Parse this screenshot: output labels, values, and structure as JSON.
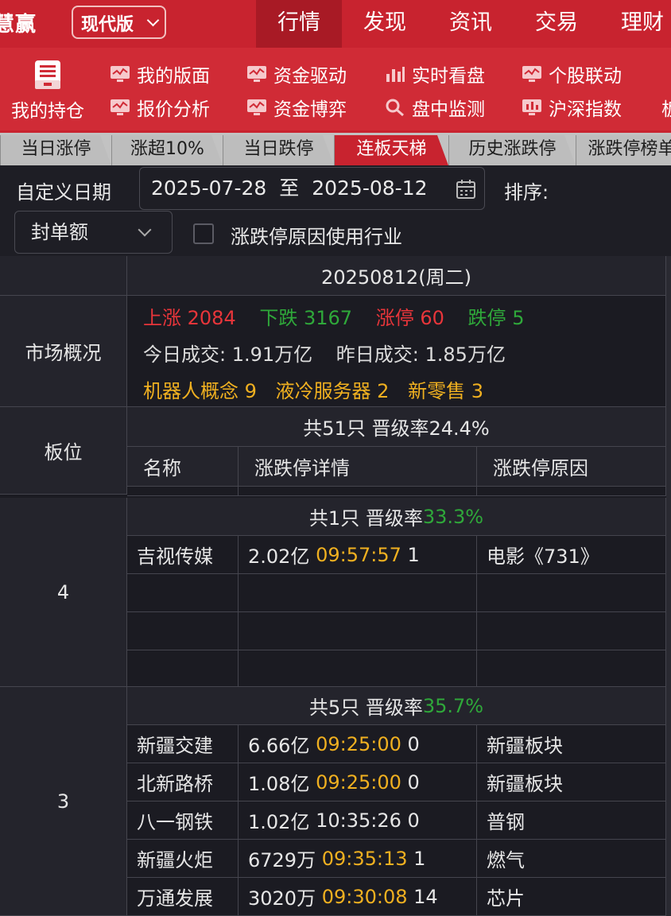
{
  "app": {
    "brand": "慧赢",
    "edition": "现代版"
  },
  "nav": {
    "tabs": [
      {
        "label": "行情",
        "active": true
      },
      {
        "label": "发现",
        "active": false
      },
      {
        "label": "资讯",
        "active": false
      },
      {
        "label": "交易",
        "active": false
      },
      {
        "label": "理财",
        "active": false
      }
    ]
  },
  "toolbar": {
    "holdings": "我的持仓",
    "items": [
      {
        "label": "我的版面",
        "icon": "monitor-icon"
      },
      {
        "label": "资金驱动",
        "icon": "monitor-icon"
      },
      {
        "label": "实时看盘",
        "icon": "bar-chart-icon"
      },
      {
        "label": "个股联动",
        "icon": "monitor-icon"
      },
      {
        "label": "报价分析",
        "icon": "monitor-icon"
      },
      {
        "label": "资金博弈",
        "icon": "monitor-icon"
      },
      {
        "label": "盘中监测",
        "icon": "search-icon"
      },
      {
        "label": "沪深指数",
        "icon": "monitor-icon"
      },
      {
        "label": "板",
        "icon": ""
      }
    ]
  },
  "tabs": [
    {
      "label": "当日涨停",
      "active": false
    },
    {
      "label": "涨超10%",
      "active": false
    },
    {
      "label": "当日跌停",
      "active": false
    },
    {
      "label": "连板天梯",
      "active": true
    },
    {
      "label": "历史涨跌停",
      "active": false
    },
    {
      "label": "涨跌停榜单",
      "active": false
    }
  ],
  "filter": {
    "date_label": "自定义日期",
    "start": "2025-07-28",
    "sep": "至",
    "end": "2025-08-12",
    "sort_label": "排序:",
    "sort_value": "封单额",
    "reason_checkbox": "涨跌停原因使用行业",
    "reason_checked": false
  },
  "grid": {
    "date_header": "20250812(周二)",
    "overview_label": "市场概况",
    "overview": {
      "up_label": "上涨",
      "up": "2084",
      "down_label": "下跌",
      "down": "3167",
      "limit_up_label": "涨停",
      "limit_up": "60",
      "limit_down_label": "跌停",
      "limit_down": "5",
      "today_volume": "今日成交: 1.91万亿",
      "yesterday_volume": "昨日成交: 1.85万亿",
      "hot_sectors": "机器人概念 9",
      "hot_sectors_2": "液冷服务器 2",
      "hot_sectors_3": "新零售 3"
    },
    "board_label": "板位",
    "summary": "共51只 晋级率24.4%",
    "columns": [
      "名称",
      "涨跌停详情",
      "涨跌停原因"
    ],
    "groups": [
      {
        "level": "4",
        "summary_prefix": "共1只 晋级率",
        "rate": "33.3%",
        "rows": [
          {
            "name": "吉视传媒",
            "amount": "2.02亿",
            "time": "09:57:57",
            "times_orange": true,
            "count": "1",
            "reason": "电影《731》"
          }
        ]
      },
      {
        "level": "3",
        "summary_prefix": "共5只 晋级率",
        "rate": "35.7%",
        "rows": [
          {
            "name": "新疆交建",
            "amount": "6.66亿",
            "time": "09:25:00",
            "times_orange": true,
            "count": "0",
            "reason": "新疆板块"
          },
          {
            "name": "北新路桥",
            "amount": "1.08亿",
            "time": "09:25:00",
            "times_orange": true,
            "count": "0",
            "reason": "新疆板块"
          },
          {
            "name": "八一钢铁",
            "amount": "1.02亿",
            "time": "10:35:26",
            "times_orange": false,
            "count": "0",
            "reason": "普钢"
          },
          {
            "name": "新疆火炬",
            "amount": "6729万",
            "time": "09:35:13",
            "times_orange": true,
            "count": "1",
            "reason": "燃气"
          },
          {
            "name": "万通发展",
            "amount": "3020万",
            "time": "09:30:08",
            "times_orange": true,
            "count": "14",
            "reason": "芯片"
          }
        ]
      }
    ]
  },
  "colors": {
    "brand_red": "#c8232f",
    "up": "#e8353a",
    "down": "#2fa83a",
    "time": "#f0b020"
  }
}
